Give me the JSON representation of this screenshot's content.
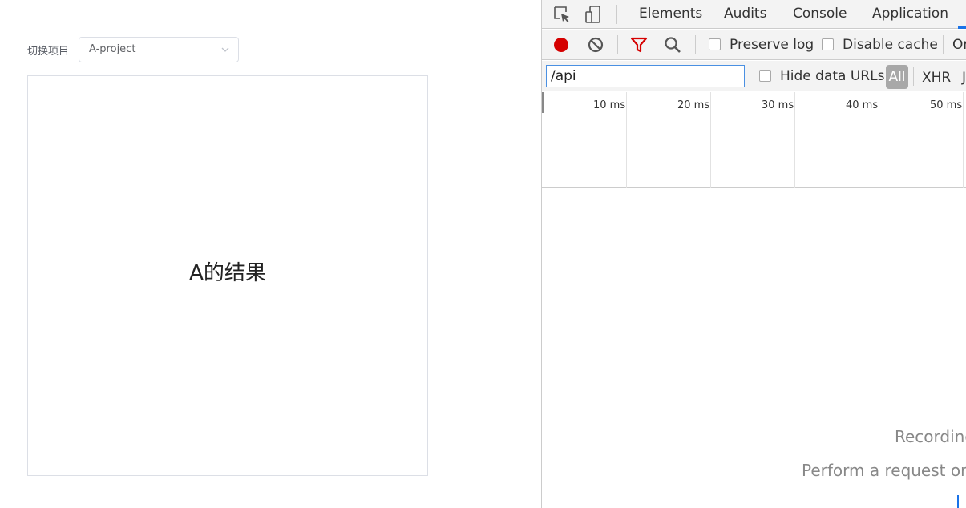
{
  "app": {
    "switch_label": "切换项目",
    "project_select": {
      "value": "A-project"
    },
    "result_text": "A的结果"
  },
  "devtools": {
    "tabs": [
      "Elements",
      "Audits",
      "Console",
      "Application"
    ],
    "toolbar": {
      "preserve_log_label": "Preserve log",
      "preserve_log_checked": false,
      "disable_cache_label": "Disable cache",
      "disable_cache_checked": false,
      "truncated_label": "Or"
    },
    "filter": {
      "value": "/api",
      "hide_data_urls_label": "Hide data URLs",
      "hide_data_urls_checked": false,
      "types": [
        "All",
        "XHR",
        "J"
      ]
    },
    "timeline": {
      "ticks": [
        "10 ms",
        "20 ms",
        "30 ms",
        "40 ms",
        "50 ms"
      ]
    },
    "empty_state": {
      "line1": "Recording",
      "line2": "Perform a request or h"
    },
    "colors": {
      "record": "#d50000",
      "filter_icon": "#d50000",
      "accent": "#1a73e8"
    }
  }
}
